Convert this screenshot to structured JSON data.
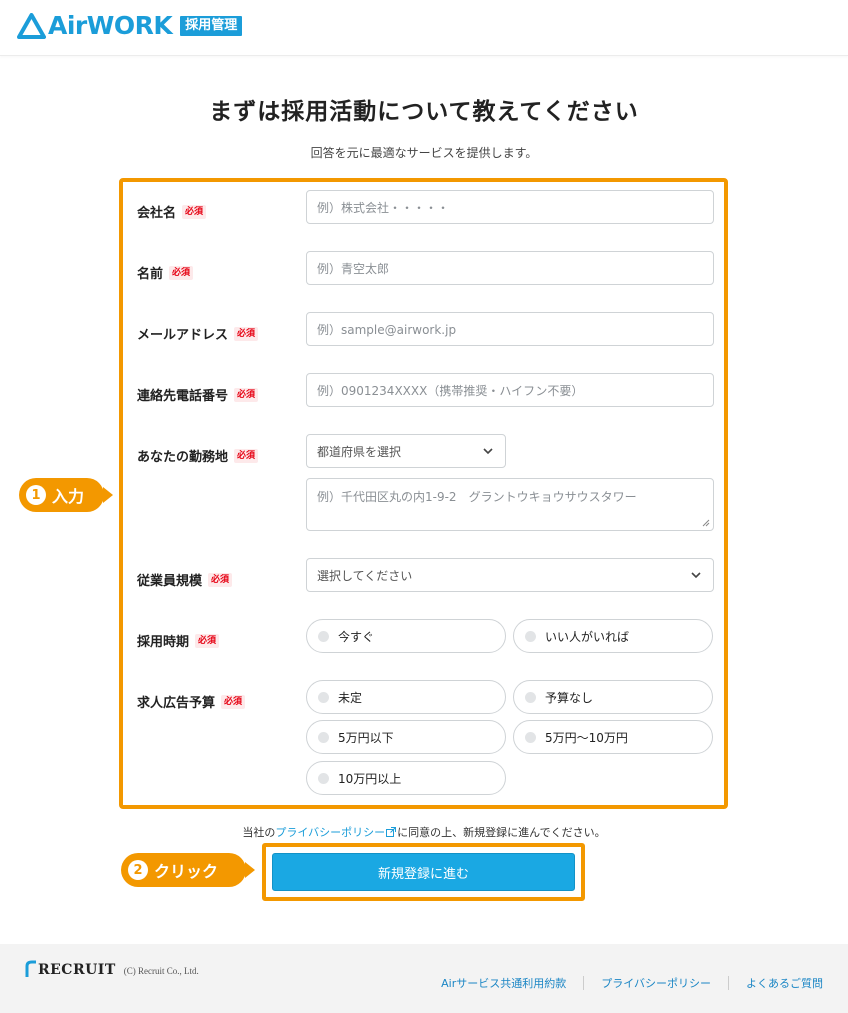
{
  "header": {
    "logo_text": "AirWORK",
    "badge": "採用管理"
  },
  "page": {
    "title": "まずは採用活動について教えてください",
    "subtitle": "回答を元に最適なサービスを提供します。"
  },
  "form": {
    "required_label": "必須",
    "company": {
      "label": "会社名",
      "placeholder": "例）株式会社・・・・・"
    },
    "name": {
      "label": "名前",
      "placeholder": "例）青空太郎"
    },
    "email": {
      "label": "メールアドレス",
      "placeholder": "例）sample@airwork.jp"
    },
    "phone": {
      "label": "連絡先電話番号",
      "placeholder": "例）0901234XXXX（携帯推奨・ハイフン不要）"
    },
    "workplace": {
      "label": "あなたの勤務地",
      "prefecture_select": "都道府県を選択",
      "address_placeholder": "例）千代田区丸の内1-9-2　グラントウキョウサウスタワー"
    },
    "employees": {
      "label": "従業員規模",
      "select": "選択してください"
    },
    "hiring_timing": {
      "label": "採用時期",
      "options": [
        "今すぐ",
        "いい人がいれば"
      ]
    },
    "ad_budget": {
      "label": "求人広告予算",
      "options": [
        "未定",
        "予算なし",
        "5万円以下",
        "5万円〜10万円",
        "10万円以上"
      ]
    }
  },
  "callouts": {
    "step1": {
      "num": "1",
      "text": "入力"
    },
    "step2": {
      "num": "2",
      "text": "クリック"
    }
  },
  "policy": {
    "prefix": "当社の",
    "link": "プライバシーポリシー",
    "suffix": "に同意の上、新規登録に進んでください。"
  },
  "submit_label": "新規登録に進む",
  "footer": {
    "company": "RECRUIT",
    "copyright": "(C) Recruit Co., Ltd.",
    "links": [
      "Airサービス共通利用約款",
      "プライバシーポリシー",
      "よくあるご質問"
    ]
  },
  "colors": {
    "brand": "#1b9dd9",
    "accent": "#f39800",
    "required": "#e60012",
    "button": "#1aa8e3"
  }
}
